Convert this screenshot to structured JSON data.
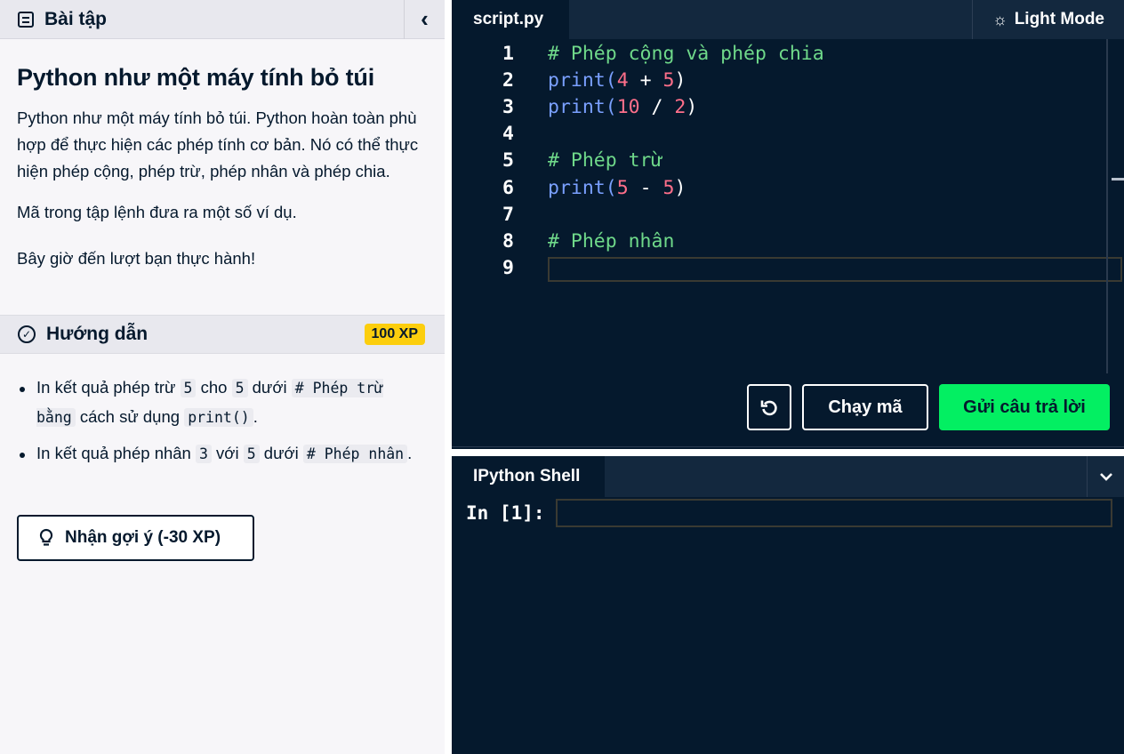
{
  "left_panel": {
    "header_title": "Bài tập",
    "exercise_title": "Python như một máy tính bỏ túi",
    "paragraph_1": "Python như một máy tính bỏ túi. Python hoàn toàn phù hợp để thực hiện các phép tính cơ bản. Nó có thể thực hiện phép cộng, phép trừ, phép nhân và phép chia.",
    "paragraph_2": "Mã trong tập lệnh đưa ra một số ví dụ.",
    "paragraph_3": "Bây giờ đến lượt bạn thực hành!"
  },
  "instructions": {
    "header_label": "Hướng dẫn",
    "xp_badge": "100 XP",
    "item1": {
      "t1": "In kết quả phép trừ ",
      "c1": "5",
      "t2": " cho ",
      "c2": "5",
      "t3": " dưới ",
      "c3": "# Phép trừ bằng",
      "t4": " cách sử dụng ",
      "c4": "print()",
      "t5": "."
    },
    "item2": {
      "t1": "In kết quả phép nhân ",
      "c1": "3",
      "t2": " với ",
      "c2": "5",
      "t3": " dưới ",
      "c3": "# Phép nhân",
      "t4": "."
    },
    "hint_button": "Nhận gợi ý (-30 XP)"
  },
  "editor": {
    "tab_label": "script.py",
    "light_mode_label": "Light Mode",
    "lines": {
      "n1": "1",
      "n2": "2",
      "n3": "3",
      "n4": "4",
      "n5": "5",
      "n6": "6",
      "n7": "7",
      "n8": "8",
      "n9": "9",
      "l1_comment": "# Phép cộng và phép chia",
      "l2_fn": "print",
      "l2_open": "(",
      "l2_a": "4",
      "l2_op": " + ",
      "l2_b": "5",
      "l2_close": ")",
      "l3_fn": "print",
      "l3_open": "(",
      "l3_a": "10",
      "l3_op": " / ",
      "l3_b": "2",
      "l3_close": ")",
      "l5_comment": "# Phép trừ",
      "l6_fn": "print",
      "l6_open": "(",
      "l6_a": "5",
      "l6_op": " - ",
      "l6_b": "5",
      "l6_close": ")",
      "l8_comment": "# Phép nhân"
    },
    "run_button": "Chạy mã",
    "submit_button": "Gửi câu trả lời"
  },
  "shell": {
    "tab_label": "IPython Shell",
    "prompt": "In [1]:"
  },
  "colors": {
    "background_dark": "#05192d",
    "submit_green": "#03ef62",
    "xp_yellow": "#fcce0d",
    "comment_green": "#6fd98a",
    "keyword_blue": "#7aa0ff",
    "number_red": "#ff6f8a"
  },
  "icons": {
    "header": "list-icon",
    "collapse": "chevron-left-icon",
    "instructions": "check-circle-icon",
    "hint": "lightbulb-icon",
    "light_mode": "sun-icon",
    "reset": "reset-icon",
    "shell_toggle": "chevron-down-icon"
  }
}
